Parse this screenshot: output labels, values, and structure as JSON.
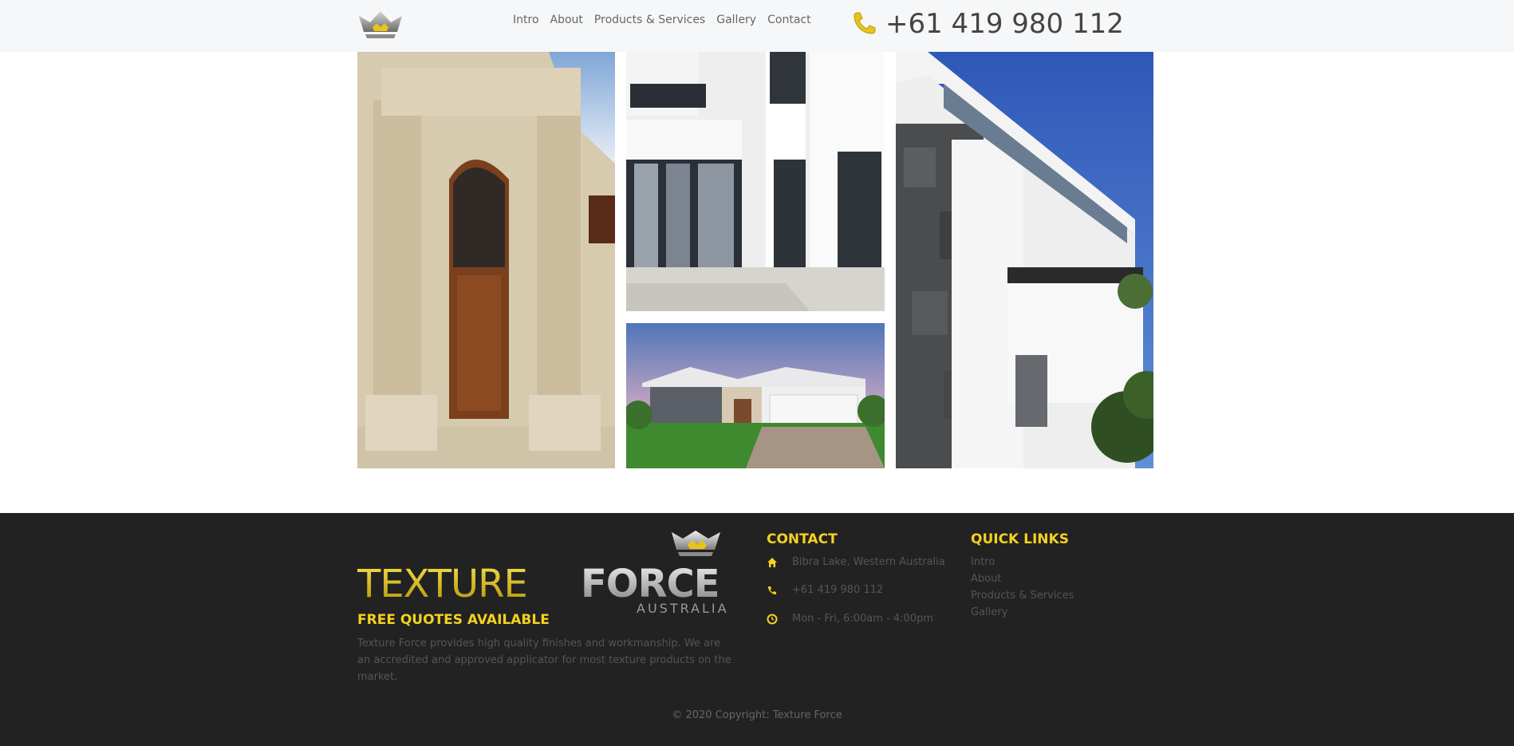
{
  "header": {
    "nav": [
      "Intro",
      "About",
      "Products & Services",
      "Gallery",
      "Contact"
    ],
    "phone": "+61 419 980 112"
  },
  "gallery": {
    "images": [
      "house-entrance-photo",
      "modern-house-photo",
      "single-storey-house-photo",
      "white-house-stone-wall-photo"
    ]
  },
  "footer": {
    "logo_word_1": "TEXTURE",
    "logo_word_2": "FORCE",
    "logo_word_3": "AUSTRALIA",
    "free_quotes": "FREE QUOTES AVAILABLE",
    "about": "Texture Force provides high quality finishes and workmanship. We are an accredited and approved applicator for most texture products on the market.",
    "contact_title": "CONTACT",
    "contact": {
      "address": "Bibra Lake, Western Australia",
      "phone": "+61 419 980 112",
      "hours": "Mon - Fri, 6:00am - 4:00pm"
    },
    "quick_title": "QUICK LINKS",
    "quick_links": [
      "Intro",
      "About",
      "Products & Services",
      "Gallery"
    ],
    "copyright": "© 2020 Copyright: Texture Force"
  },
  "colors": {
    "accent": "#f4d21f",
    "footer_bg": "#222222",
    "header_bg": "#f6f7f8"
  }
}
